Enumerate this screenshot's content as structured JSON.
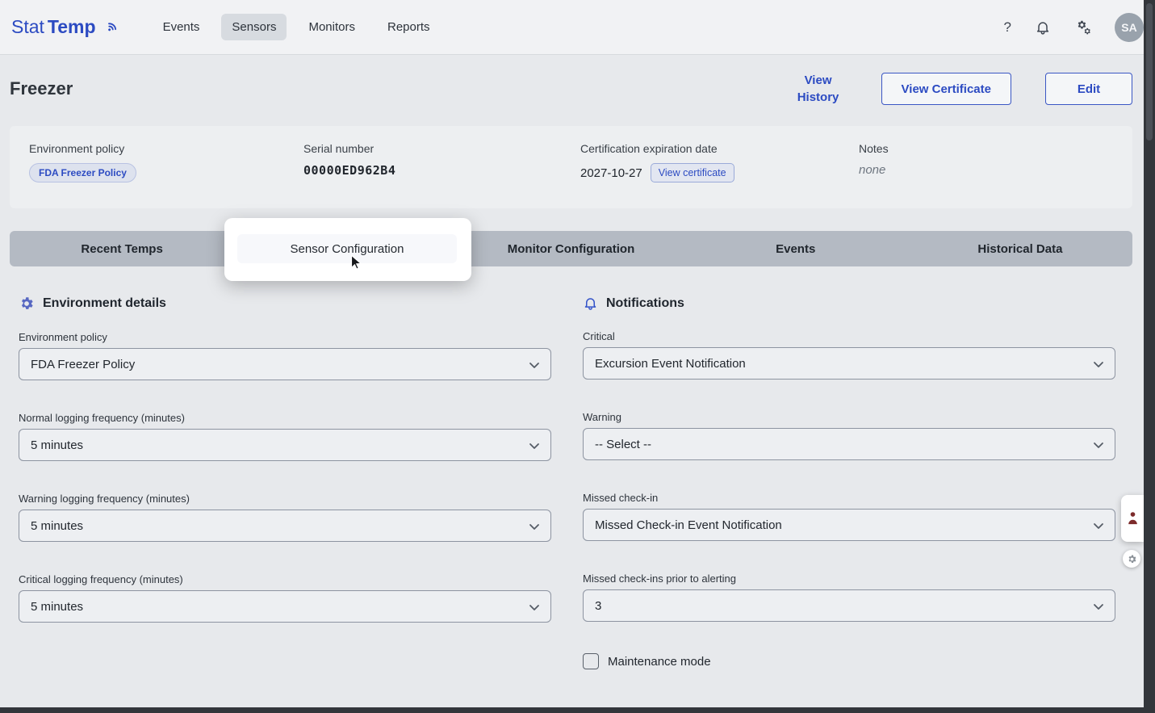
{
  "colors": {
    "accent": "#2c4bc2",
    "tabbar": "#b4bac3",
    "page_bg": "#e7e9ec"
  },
  "nav": {
    "brand_stat": "Stat",
    "brand_temp": "Temp",
    "items": [
      {
        "label": "Events"
      },
      {
        "label": "Sensors",
        "active": true
      },
      {
        "label": "Monitors"
      },
      {
        "label": "Reports"
      }
    ],
    "help": "?",
    "avatar": "SA"
  },
  "header": {
    "title": "Freezer",
    "view_history": "View History",
    "view_certificate": "View Certificate",
    "edit": "Edit"
  },
  "summary": {
    "environment_policy_label": "Environment policy",
    "environment_policy_value": "FDA Freezer Policy",
    "serial_label": "Serial number",
    "serial_value": "00000ED962B4",
    "cert_label": "Certification expiration date",
    "cert_value": "2027-10-27",
    "view_certificate_small": "View certificate",
    "notes_label": "Notes",
    "notes_value": "none"
  },
  "tabs": [
    {
      "label": "Recent Temps"
    },
    {
      "label": "Sensor Configuration",
      "highlighted": true
    },
    {
      "label": "Monitor Configuration"
    },
    {
      "label": "Events"
    },
    {
      "label": "Historical Data"
    }
  ],
  "environment_details": {
    "title": "Environment details",
    "fields": [
      {
        "label": "Environment policy",
        "value": "FDA Freezer Policy"
      },
      {
        "label": "Normal logging frequency (minutes)",
        "value": "5 minutes"
      },
      {
        "label": "Warning logging frequency (minutes)",
        "value": "5 minutes"
      },
      {
        "label": "Critical logging frequency (minutes)",
        "value": "5 minutes"
      }
    ]
  },
  "notifications": {
    "title": "Notifications",
    "fields": [
      {
        "label": "Critical",
        "value": "Excursion Event Notification"
      },
      {
        "label": "Warning",
        "value": "-- Select --"
      },
      {
        "label": "Missed check-in",
        "value": "Missed Check-in Event Notification"
      },
      {
        "label": "Missed check-ins prior to alerting",
        "value": "3"
      }
    ],
    "maintenance_mode_label": "Maintenance mode",
    "maintenance_mode_checked": false
  }
}
